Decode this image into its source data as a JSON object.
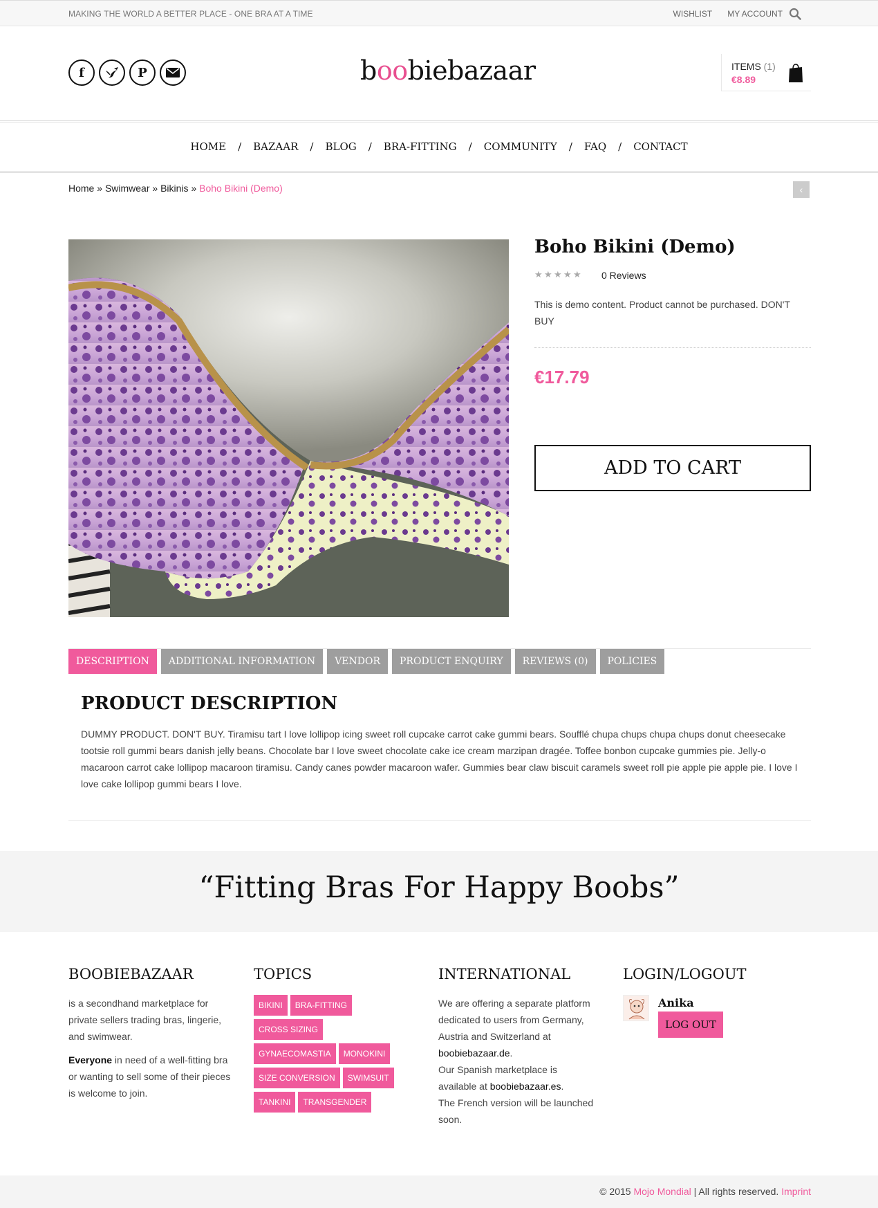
{
  "topbar": {
    "tagline": "MAKING THE WORLD A BETTER PLACE - ONE BRA AT A TIME",
    "wishlist": "WISHLIST",
    "account": "MY ACCOUNT"
  },
  "header": {
    "logo_pre": "b",
    "logo_oo": "oo",
    "logo_post": "biebazaar",
    "socials": [
      "f",
      "bird",
      "P",
      "mail"
    ],
    "cart_items_label": "ITEMS",
    "cart_items_count": "(1)",
    "cart_total": "€8.89"
  },
  "nav": {
    "items": [
      "HOME",
      "BAZAAR",
      "BLOG",
      "BRA-FITTING",
      "COMMUNITY",
      "FAQ",
      "CONTACT"
    ],
    "separator": "/"
  },
  "breadcrumb": {
    "home": "Home",
    "swimwear": "Swimwear",
    "bikinis": "Bikinis",
    "current": "Boho Bikini (Demo)",
    "sep": " » "
  },
  "product": {
    "title": "Boho Bikini (Demo)",
    "rating": 0,
    "reviews": "0 Reviews",
    "short_description": "This is demo content. Product cannot be purchased. DON'T BUY",
    "price": "€17.79",
    "add_to_cart": "ADD TO CART"
  },
  "tabs": {
    "items": [
      "DESCRIPTION",
      "ADDITIONAL INFORMATION",
      "VENDOR",
      "PRODUCT ENQUIRY",
      "REVIEWS (0)",
      "POLICIES"
    ]
  },
  "description": {
    "heading": "PRODUCT DESCRIPTION",
    "body": "DUMMY PRODUCT. DON'T BUY. Tiramisu tart I love lollipop icing sweet roll cupcake carrot cake gummi bears. Soufflé chupa chups chupa chups donut cheesecake tootsie roll gummi bears danish jelly beans. Chocolate bar I love sweet chocolate cake ice cream marzipan dragée. Toffee bonbon cupcake gummies pie. Jelly-o macaroon carrot cake lollipop macaroon tiramisu. Candy canes powder macaroon wafer. Gummies bear claw biscuit caramels sweet roll pie apple pie apple pie. I love I love cake lollipop gummi bears I love."
  },
  "quote": "“Fitting Bras For Happy Boobs”",
  "footer": {
    "about_heading": "BOOBIEBAZAAR",
    "about_text": "is a secondhand marketplace for private sellers trading bras, lingerie, and swimwear.",
    "about_bold": "Everyone",
    "about_text2": " in need of a well-fitting bra or wanting to sell some of their pieces is welcome to join.",
    "topics_heading": "TOPICS",
    "topics": [
      "BIKINI",
      "BRA-FITTING",
      "CROSS SIZING",
      "GYNAECOMASTIA",
      "MONOKINI",
      "SIZE CONVERSION",
      "SWIMSUIT",
      "TANKINI",
      "TRANSGENDER"
    ],
    "intl_heading": "INTERNATIONAL",
    "intl_text1": "We are offering a separate platform dedicated to users from Germany, Austria and Switzerland at ",
    "intl_link_de": "boobiebazaar.de",
    "intl_text2": ".",
    "intl_text3": "Our Spanish marketplace is available at ",
    "intl_link_es": "boobiebazaar.es",
    "intl_text4": ".",
    "intl_text5": "The French version will be launched soon.",
    "login_heading": "LOGIN/LOGOUT",
    "username": "Anika",
    "logout": "LOG OUT"
  },
  "copyright": {
    "prefix": "© 2015 ",
    "company": "Mojo Mondial",
    "middle": " | All rights reserved. ",
    "imprint": "Imprint"
  },
  "colors": {
    "accent": "#f05a9c",
    "tab_inactive": "#9e9e9e"
  }
}
